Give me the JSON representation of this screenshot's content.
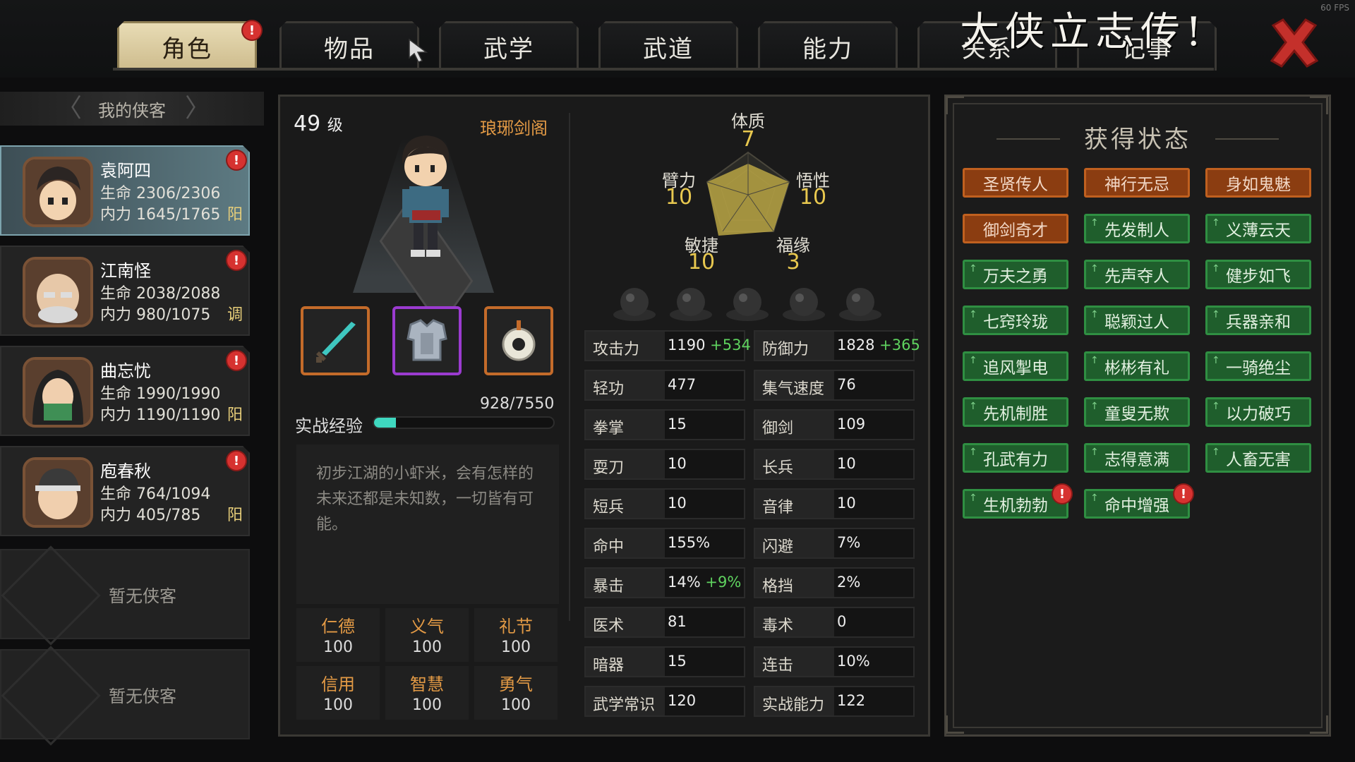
{
  "window": {
    "title": "大侠立志传!",
    "fps": "60 FPS"
  },
  "tabs": [
    {
      "label": "角色",
      "active": true
    },
    {
      "label": "物品"
    },
    {
      "label": "武学"
    },
    {
      "label": "武道"
    },
    {
      "label": "能力"
    },
    {
      "label": "关系"
    },
    {
      "label": "记事"
    }
  ],
  "sidebar": {
    "header": "我的侠客",
    "heroes": [
      {
        "name": "袁阿四",
        "hp": "生命 2306/2306",
        "mp": "内力 1645/1765",
        "tag": "阳"
      },
      {
        "name": "江南怪",
        "hp": "生命 2038/2088",
        "mp": "内力 980/1075",
        "tag": "调"
      },
      {
        "name": "曲忘忧",
        "hp": "生命 1990/1990",
        "mp": "内力 1190/1190",
        "tag": "阳"
      },
      {
        "name": "庖春秋",
        "hp": "生命 764/1094",
        "mp": "内力 405/785",
        "tag": "阳"
      }
    ],
    "empty_slots": [
      "暂无侠客",
      "暂无侠客"
    ]
  },
  "character": {
    "level": "49",
    "level_unit": "级",
    "sect": "琅琊剑阁",
    "exp_label": "实战经验",
    "exp_value": "928/7550",
    "exp_fraction": 0.123,
    "description": "初步江湖的小虾米，会有怎样的未来还都是未知数，一切皆有可能。",
    "virtues": [
      {
        "label": "仁德",
        "value": "100"
      },
      {
        "label": "义气",
        "value": "100"
      },
      {
        "label": "礼节",
        "value": "100"
      },
      {
        "label": "信用",
        "value": "100"
      },
      {
        "label": "智慧",
        "value": "100"
      },
      {
        "label": "勇气",
        "value": "100"
      }
    ]
  },
  "attributes": {
    "tizhi": {
      "label": "体质",
      "value": "7"
    },
    "bili": {
      "label": "臂力",
      "value": "10"
    },
    "wuxing": {
      "label": "悟性",
      "value": "10"
    },
    "minjie": {
      "label": "敏捷",
      "value": "10"
    },
    "fuyuan": {
      "label": "福缘",
      "value": "3"
    }
  },
  "stats": [
    {
      "label": "攻击力",
      "value": "1190",
      "bonus": "+534"
    },
    {
      "label": "防御力",
      "value": "1828",
      "bonus": "+365"
    },
    {
      "label": "轻功",
      "value": "477",
      "bonus": ""
    },
    {
      "label": "集气速度",
      "value": "76",
      "bonus": ""
    },
    {
      "label": "拳掌",
      "value": "15",
      "bonus": ""
    },
    {
      "label": "御剑",
      "value": "109",
      "bonus": ""
    },
    {
      "label": "耍刀",
      "value": "10",
      "bonus": ""
    },
    {
      "label": "长兵",
      "value": "10",
      "bonus": ""
    },
    {
      "label": "短兵",
      "value": "10",
      "bonus": ""
    },
    {
      "label": "音律",
      "value": "10",
      "bonus": ""
    },
    {
      "label": "命中",
      "value": "155%",
      "bonus": ""
    },
    {
      "label": "闪避",
      "value": "7%",
      "bonus": ""
    },
    {
      "label": "暴击",
      "value": "14%",
      "bonus": "+9%"
    },
    {
      "label": "格挡",
      "value": "2%",
      "bonus": ""
    },
    {
      "label": "医术",
      "value": "81",
      "bonus": ""
    },
    {
      "label": "毒术",
      "value": "0",
      "bonus": ""
    },
    {
      "label": "暗器",
      "value": "15",
      "bonus": ""
    },
    {
      "label": "连击",
      "value": "10%",
      "bonus": ""
    },
    {
      "label": "武学常识",
      "value": "120",
      "bonus": ""
    },
    {
      "label": "实战能力",
      "value": "122",
      "bonus": ""
    }
  ],
  "status_panel": {
    "title": "获得状态",
    "items": [
      {
        "label": "圣贤传人",
        "color": "orange"
      },
      {
        "label": "神行无忌",
        "color": "orange"
      },
      {
        "label": "身如鬼魅",
        "color": "orange"
      },
      {
        "label": "御剑奇才",
        "color": "orange"
      },
      {
        "label": "先发制人",
        "color": "green"
      },
      {
        "label": "义薄云天",
        "color": "green"
      },
      {
        "label": "万夫之勇",
        "color": "green"
      },
      {
        "label": "先声夺人",
        "color": "green"
      },
      {
        "label": "健步如飞",
        "color": "green"
      },
      {
        "label": "七窍玲珑",
        "color": "green"
      },
      {
        "label": "聪颖过人",
        "color": "green"
      },
      {
        "label": "兵器亲和",
        "color": "green"
      },
      {
        "label": "追风掣电",
        "color": "green"
      },
      {
        "label": "彬彬有礼",
        "color": "green"
      },
      {
        "label": "一骑绝尘",
        "color": "green"
      },
      {
        "label": "先机制胜",
        "color": "green"
      },
      {
        "label": "童叟无欺",
        "color": "green"
      },
      {
        "label": "以力破巧",
        "color": "green"
      },
      {
        "label": "孔武有力",
        "color": "green"
      },
      {
        "label": "志得意满",
        "color": "green"
      },
      {
        "label": "人畜无害",
        "color": "green"
      },
      {
        "label": "生机勃勃",
        "color": "green"
      },
      {
        "label": "命中增强",
        "color": "green"
      }
    ]
  },
  "colors": {
    "accent": "#e39a45",
    "exp": "#3fd8c0",
    "bonus": "#5fd35f",
    "attr": "#e8c84f"
  }
}
